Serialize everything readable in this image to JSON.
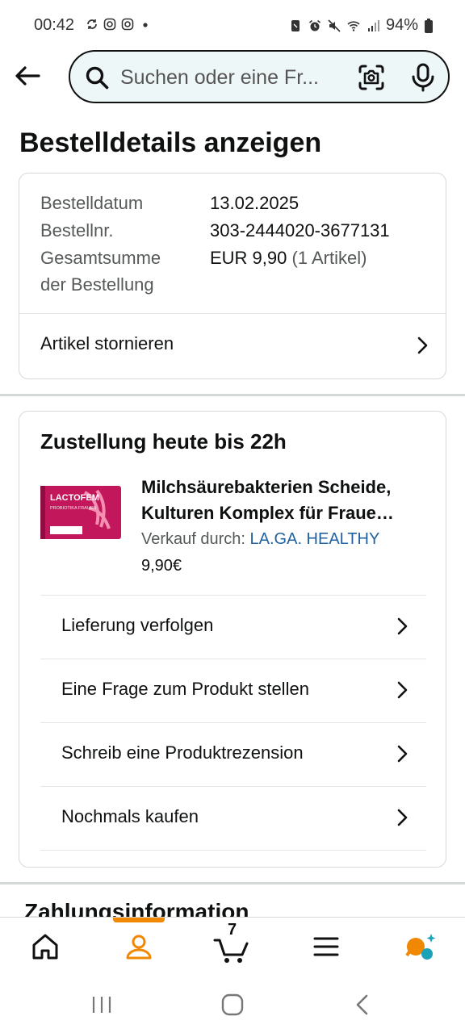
{
  "status_bar": {
    "time": "00:42",
    "battery": "94%",
    "left_icons": [
      "sync-icon",
      "instagram-icon",
      "instagram-icon",
      "dot-icon"
    ],
    "right_icons": [
      "nfc-icon",
      "alarm-icon",
      "mute-icon",
      "wifi-icon",
      "signal-icon",
      "battery-icon"
    ]
  },
  "search": {
    "placeholder": "Suchen oder eine Fr..."
  },
  "page": {
    "title": "Bestelldetails anzeigen"
  },
  "order": {
    "date_label": "Bestelldatum",
    "date_value": "13.02.2025",
    "number_label": "Bestellnr.",
    "number_value": "303-2444020-3677131",
    "total_label_line1": "Gesamtsumme",
    "total_label_line2": "der Bestellung",
    "total_value": "EUR 9,90",
    "total_items": "(1 Artikel)",
    "cancel_label": "Artikel stornieren"
  },
  "delivery": {
    "heading": "Zustellung heute bis 22h",
    "product_title_line1": "Milchsäurebakterien Scheide,",
    "product_title_line2": "Kulturen Komplex für Fraue…",
    "seller_prefix": "Verkauf durch: ",
    "seller_name": "LA.GA. HEALTHY",
    "price": "9,90€",
    "product_image_text": "LACTOFEM",
    "product_image_subtext": "PROBIOTIKA FRAUEN",
    "actions": [
      {
        "label": "Lieferung verfolgen"
      },
      {
        "label": "Eine Frage zum Produkt stellen"
      },
      {
        "label": "Schreib eine Produktrezension"
      },
      {
        "label": "Nochmals kaufen"
      }
    ]
  },
  "next_section": {
    "title": "Zahlungsinformation"
  },
  "bottom_nav": {
    "cart_count": "7",
    "active": "account",
    "accent_color": "#f08804"
  }
}
